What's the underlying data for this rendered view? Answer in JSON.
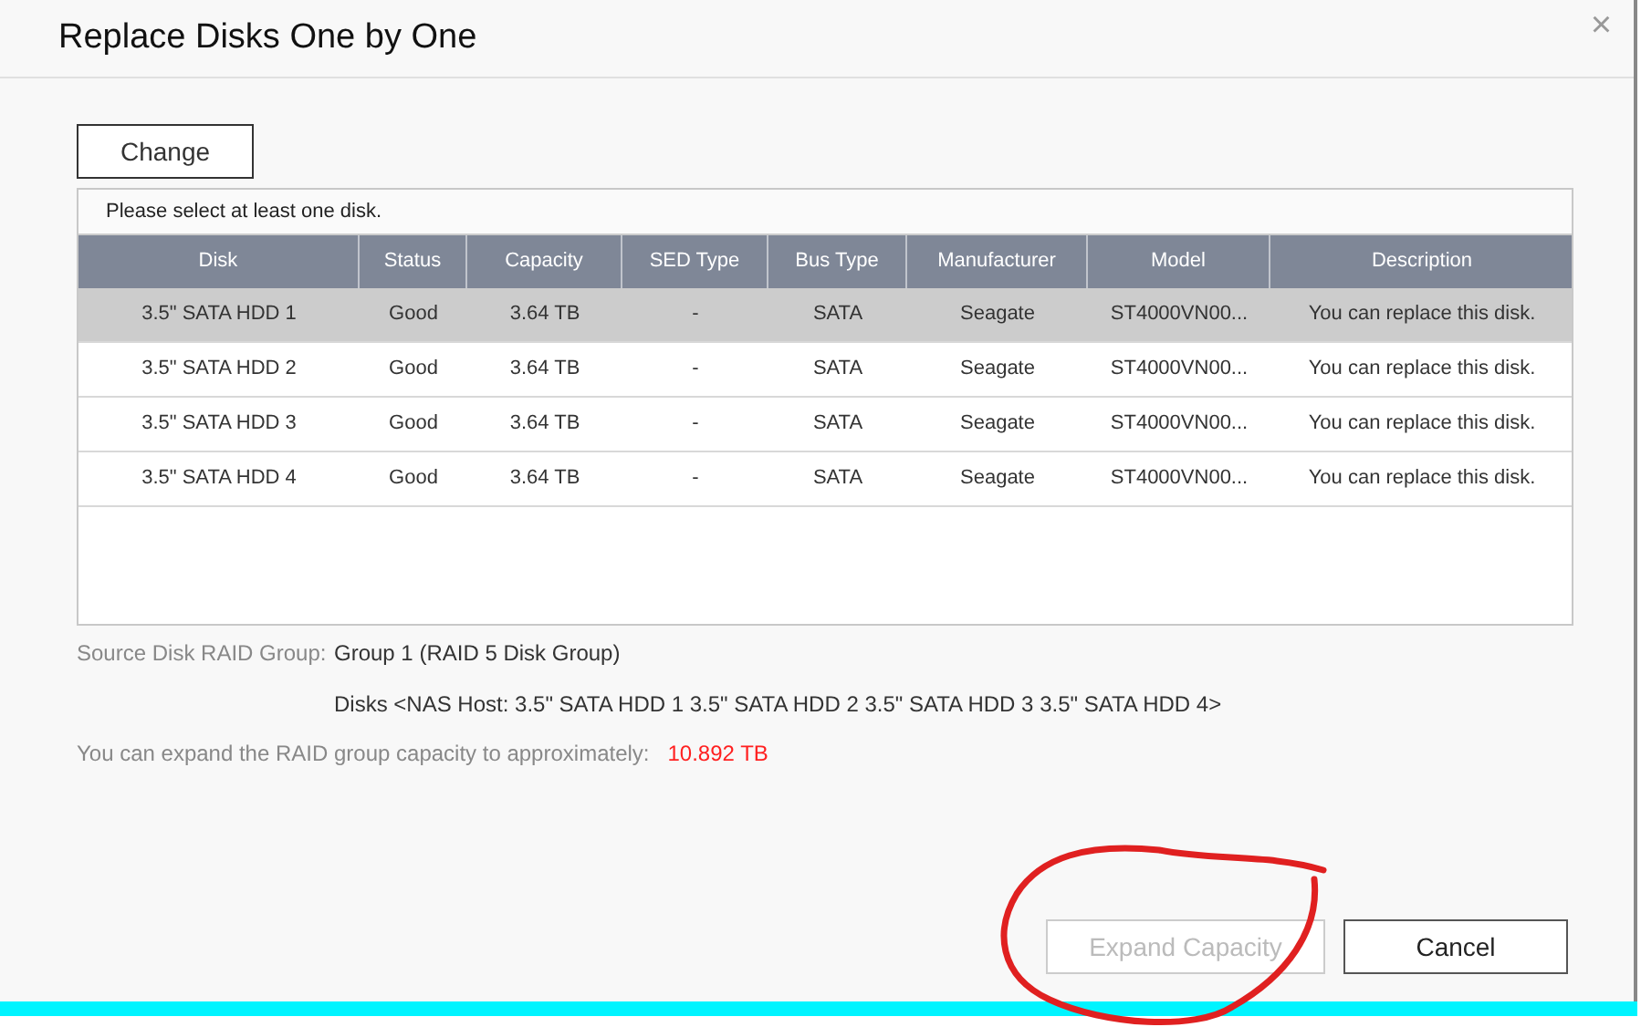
{
  "dialog": {
    "title": "Replace Disks One by One",
    "close_icon": "×"
  },
  "change_button": {
    "label": "Change"
  },
  "table": {
    "message": "Please select at least one disk.",
    "columns": [
      "Disk",
      "Status",
      "Capacity",
      "SED Type",
      "Bus Type",
      "Manufacturer",
      "Model",
      "Description"
    ],
    "rows": [
      {
        "selected": true,
        "cells": [
          "3.5\" SATA HDD 1",
          "Good",
          "3.64 TB",
          "-",
          "SATA",
          "Seagate",
          "ST4000VN00...",
          "You can replace this disk."
        ]
      },
      {
        "selected": false,
        "cells": [
          "3.5\" SATA HDD 2",
          "Good",
          "3.64 TB",
          "-",
          "SATA",
          "Seagate",
          "ST4000VN00...",
          "You can replace this disk."
        ]
      },
      {
        "selected": false,
        "cells": [
          "3.5\" SATA HDD 3",
          "Good",
          "3.64 TB",
          "-",
          "SATA",
          "Seagate",
          "ST4000VN00...",
          "You can replace this disk."
        ]
      },
      {
        "selected": false,
        "cells": [
          "3.5\" SATA HDD 4",
          "Good",
          "3.64 TB",
          "-",
          "SATA",
          "Seagate",
          "ST4000VN00...",
          "You can replace this disk."
        ]
      }
    ]
  },
  "source": {
    "label": "Source Disk RAID Group:",
    "group": "Group 1 (RAID 5 Disk Group)",
    "disks": "Disks <NAS Host: 3.5\" SATA HDD 1 3.5\" SATA HDD 2 3.5\" SATA HDD 3 3.5\" SATA HDD 4>"
  },
  "expand_info": {
    "label": "You can expand the RAID group capacity to approximately:",
    "value": "10.892 TB"
  },
  "buttons": [
    {
      "label": "Expand Capacity",
      "disabled": true
    },
    {
      "label": "Cancel",
      "disabled": false
    }
  ],
  "annotation": {
    "kind": "circle",
    "color": "#e02020"
  }
}
